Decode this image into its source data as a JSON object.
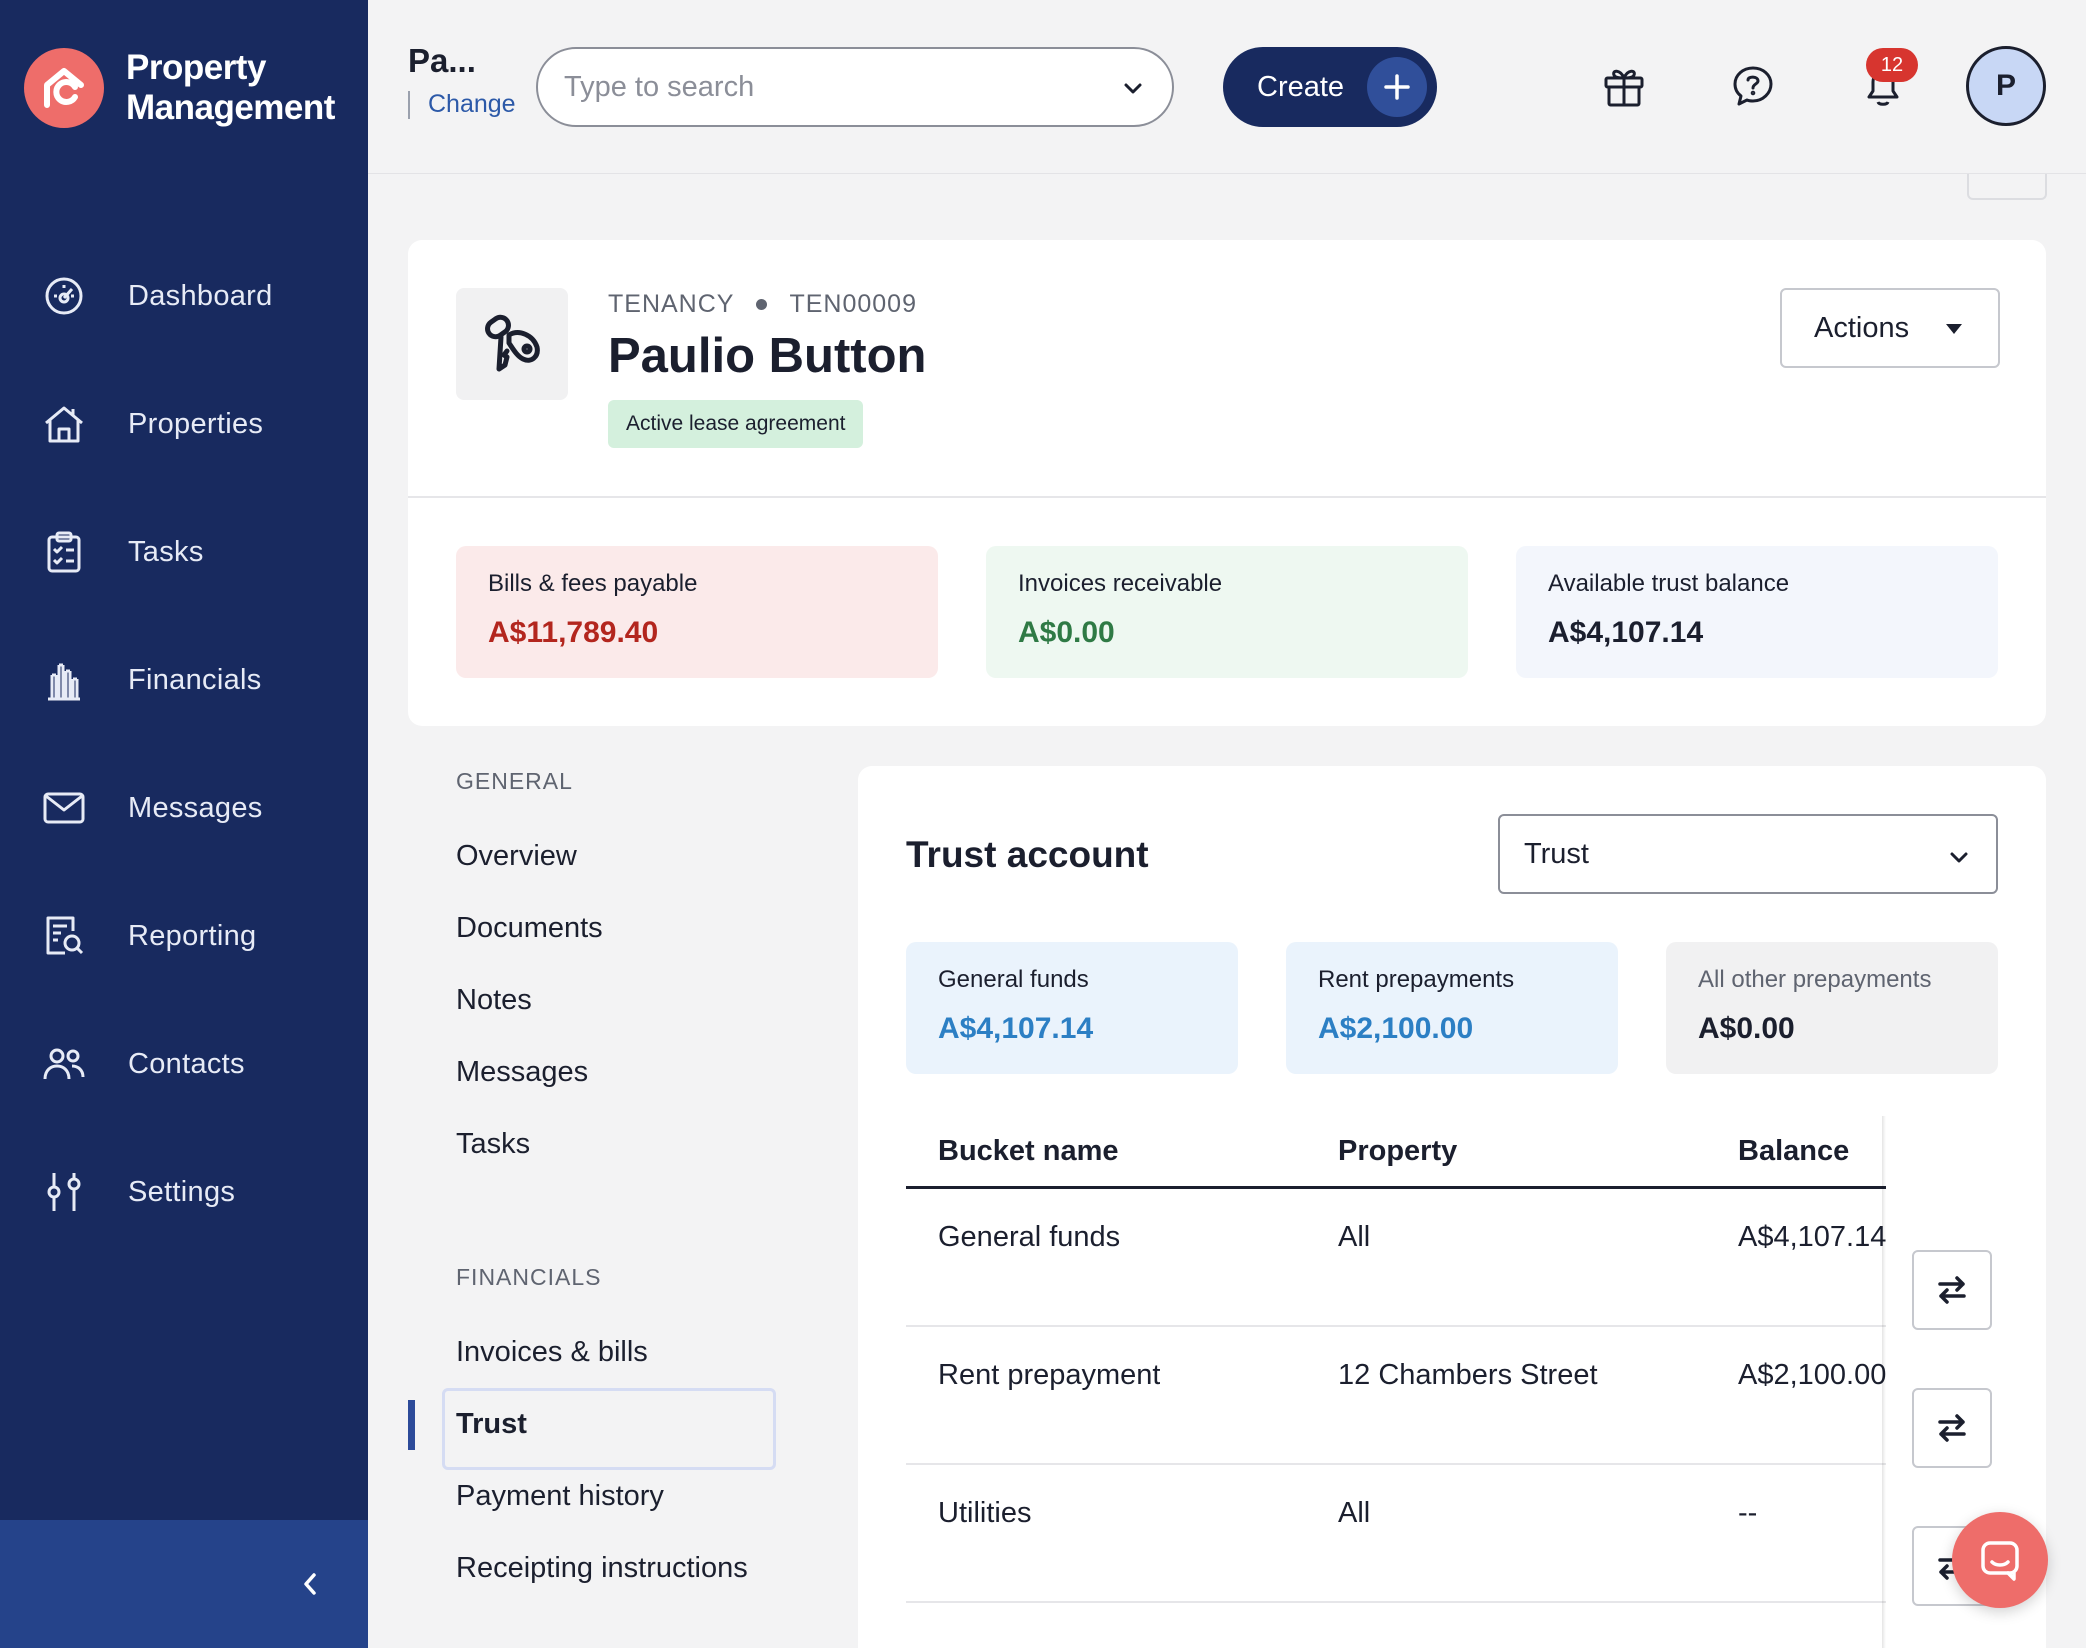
{
  "brand": {
    "name_line1": "Property",
    "name_line2": "Management",
    "logo_color": "#ee6d6a"
  },
  "sidebar": {
    "background": "#182a5f",
    "items": [
      {
        "label": "Dashboard",
        "icon": "dashboard-gauge-icon"
      },
      {
        "label": "Properties",
        "icon": "house-icon"
      },
      {
        "label": "Tasks",
        "icon": "clipboard-checklist-icon"
      },
      {
        "label": "Financials",
        "icon": "bank-columns-icon"
      },
      {
        "label": "Messages",
        "icon": "envelope-icon"
      },
      {
        "label": "Reporting",
        "icon": "report-search-icon"
      },
      {
        "label": "Contacts",
        "icon": "people-icon"
      },
      {
        "label": "Settings",
        "icon": "sliders-icon"
      }
    ],
    "collapse_icon": "chevron-left-icon"
  },
  "header": {
    "portfolio_name": "Pa...",
    "change_label": "Change",
    "search_placeholder": "Type to search",
    "create_label": "Create",
    "notifications_count": "12",
    "avatar_initial": "P",
    "icons": [
      "gift-icon",
      "help-icon",
      "bell-icon"
    ]
  },
  "tenancy": {
    "type_label": "TENANCY",
    "reference": "TEN00009",
    "name": "Paulio Button",
    "status": "Active lease agreement",
    "actions_label": "Actions",
    "metrics": [
      {
        "label": "Bills & fees payable",
        "value": "A$11,789.40",
        "bg": "#fbeaea",
        "color": "#b3261e"
      },
      {
        "label": "Invoices receivable",
        "value": "A$0.00",
        "bg": "#eef8f1",
        "color": "#2f7a45"
      },
      {
        "label": "Available trust balance",
        "value": "A$4,107.14",
        "bg": "#f3f6fc",
        "color": "#1b1f2e"
      }
    ]
  },
  "subnav": {
    "general_heading": "GENERAL",
    "general_items": [
      "Overview",
      "Documents",
      "Notes",
      "Messages",
      "Tasks"
    ],
    "financials_heading": "FINANCIALS",
    "financials_items": [
      "Invoices & bills",
      "Trust",
      "Payment history",
      "Receipting instructions"
    ],
    "active_item": "Trust"
  },
  "trust": {
    "title": "Trust account",
    "select_value": "Trust",
    "funds": [
      {
        "label": "General funds",
        "value": "A$4,107.14",
        "bg": "#eaf3fc",
        "color": "#2c7fc4"
      },
      {
        "label": "Rent prepayments",
        "value": "A$2,100.00",
        "bg": "#eaf3fc",
        "color": "#2c7fc4"
      },
      {
        "label": "All other prepayments",
        "value": "A$0.00",
        "bg": "#f1f1f2",
        "color": "#1b1f2e"
      }
    ],
    "table": {
      "headers": [
        "Bucket name",
        "Property",
        "Balance"
      ],
      "rows": [
        {
          "bucket": "General funds",
          "property": "All",
          "balance": "A$4,107.14"
        },
        {
          "bucket": "Rent prepayment",
          "property": "12 Chambers Street",
          "balance": "A$2,100.00"
        },
        {
          "bucket": "Utilities",
          "property": "All",
          "balance": "--"
        }
      ]
    }
  }
}
